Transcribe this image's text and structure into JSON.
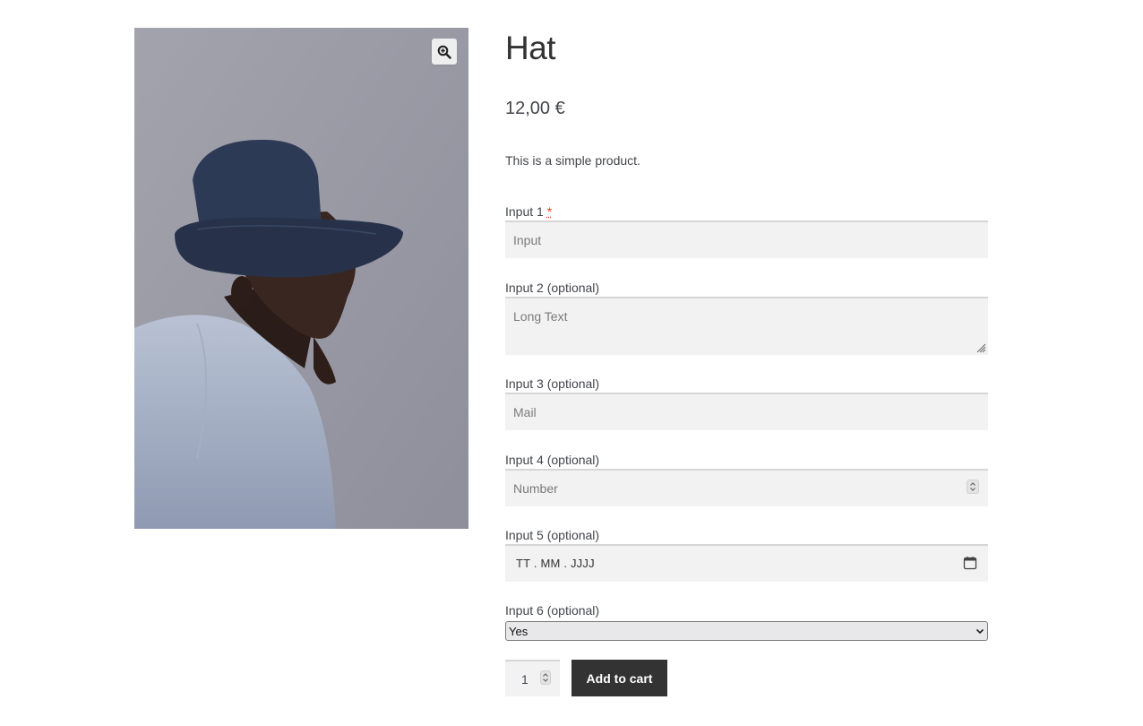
{
  "product": {
    "title": "Hat",
    "price": "12,00 €",
    "short_description": "This is a simple product.",
    "image_alt": "Person wearing a navy bucket hat",
    "zoom_icon": "zoom-in-icon"
  },
  "form": {
    "input1": {
      "label": "Input 1 ",
      "required_mark": "*",
      "placeholder": "Input"
    },
    "input2": {
      "label": "Input 2 (optional)",
      "placeholder": "Long Text"
    },
    "input3": {
      "label": "Input 3 (optional)",
      "placeholder": "Mail"
    },
    "input4": {
      "label": "Input 4 (optional)",
      "placeholder": "Number"
    },
    "input5": {
      "label": "Input 5 (optional)",
      "value": "TT . MM . JJJJ"
    },
    "input6": {
      "label": "Input 6 (optional)",
      "selected": "Yes"
    }
  },
  "cart": {
    "quantity": "1",
    "add_to_cart_label": "Add to cart"
  },
  "colors": {
    "button_bg": "#333333",
    "field_bg": "#f2f2f2",
    "required": "#e2401c"
  }
}
